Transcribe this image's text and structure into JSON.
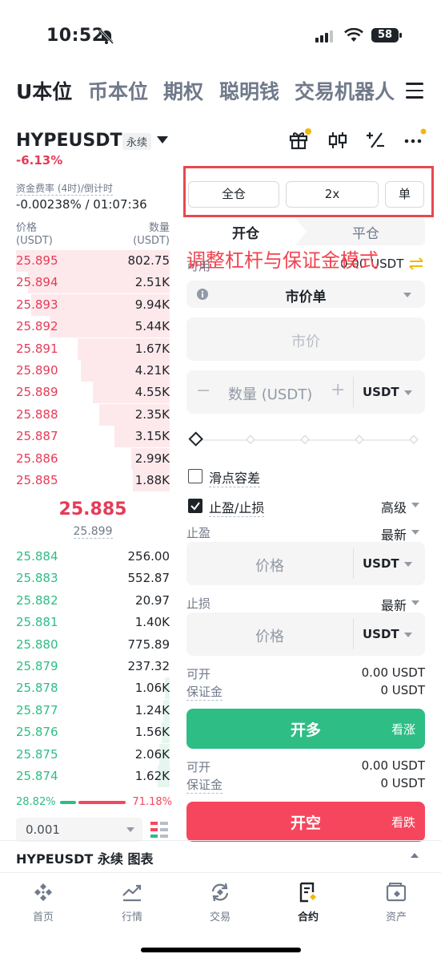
{
  "status": {
    "time": "10:52",
    "battery": "58"
  },
  "top_tabs": [
    "U本位",
    "币本位",
    "期权",
    "聪明钱",
    "交易机器人"
  ],
  "ticker": {
    "symbol": "HYPEUSDT",
    "tag": "永续",
    "change": "-6.13%",
    "funding_label": "资金费率 (4时)/倒计时",
    "funding_value": "-0.00238% / 01:07:36"
  },
  "orderbook": {
    "price_label": "价格",
    "price_unit": "(USDT)",
    "qty_label": "数量",
    "qty_unit": "(USDT)",
    "asks": [
      {
        "price": "25.895",
        "qty": "802.75",
        "depth": 1.0
      },
      {
        "price": "25.894",
        "qty": "2.51K",
        "depth": 0.92
      },
      {
        "price": "25.893",
        "qty": "9.94K",
        "depth": 0.9
      },
      {
        "price": "25.892",
        "qty": "5.44K",
        "depth": 0.78
      },
      {
        "price": "25.891",
        "qty": "1.67K",
        "depth": 0.6
      },
      {
        "price": "25.890",
        "qty": "4.21K",
        "depth": 0.58
      },
      {
        "price": "25.889",
        "qty": "4.55K",
        "depth": 0.5
      },
      {
        "price": "25.888",
        "qty": "2.35K",
        "depth": 0.46
      },
      {
        "price": "25.887",
        "qty": "3.15K",
        "depth": 0.36
      },
      {
        "price": "25.886",
        "qty": "2.99K",
        "depth": 0.25
      },
      {
        "price": "25.885",
        "qty": "1.88K",
        "depth": 0.24
      }
    ],
    "last_price": "25.885",
    "mark_price": "25.899",
    "bids": [
      {
        "price": "25.884",
        "qty": "256.00",
        "depth": 0.0
      },
      {
        "price": "25.883",
        "qty": "552.87",
        "depth": 0.0
      },
      {
        "price": "25.882",
        "qty": "20.97",
        "depth": 0.0
      },
      {
        "price": "25.881",
        "qty": "1.40K",
        "depth": 0.0
      },
      {
        "price": "25.880",
        "qty": "775.89",
        "depth": 0.0
      },
      {
        "price": "25.879",
        "qty": "237.32",
        "depth": 0.0
      },
      {
        "price": "25.878",
        "qty": "1.06K",
        "depth": 0.03
      },
      {
        "price": "25.877",
        "qty": "1.24K",
        "depth": 0.04
      },
      {
        "price": "25.876",
        "qty": "1.56K",
        "depth": 0.05
      },
      {
        "price": "25.875",
        "qty": "2.06K",
        "depth": 0.07
      },
      {
        "price": "25.874",
        "qty": "1.62K",
        "depth": 0.08
      }
    ],
    "buy_ratio": "28.82%",
    "sell_ratio": "71.18%",
    "buy_fraction": 0.2882,
    "precision": "0.001"
  },
  "order_form": {
    "margin_mode": "全仓",
    "leverage": "2x",
    "position_mode": "单",
    "open_tab": "开仓",
    "close_tab": "平仓",
    "annotation": "调整杠杆与保证金模式",
    "available_label": "可用",
    "available_value": "0.00 USDT",
    "order_type": "市价单",
    "price_placeholder": "市价",
    "qty_placeholder": "数量 (USDT)",
    "qty_unit": "USDT",
    "slippage_label": "滑点容差",
    "tpsl_label": "止盈/止损",
    "advanced_label": "高级",
    "tp_label": "止盈",
    "tp_trigger": "最新",
    "tp_placeholder": "价格",
    "tp_unit": "USDT",
    "sl_label": "止损",
    "sl_trigger": "最新",
    "sl_placeholder": "价格",
    "sl_unit": "USDT",
    "long": {
      "open_label": "可开",
      "open_value": "0.00 USDT",
      "margin_label": "保证金",
      "margin_value": "0 USDT",
      "button": "开多",
      "sub": "看涨"
    },
    "short": {
      "open_label": "可开",
      "open_value": "0.00 USDT",
      "margin_label": "保证金",
      "margin_value": "0 USDT",
      "button": "开空",
      "sub": "看跌"
    }
  },
  "chart_bar": {
    "label": "HYPEUSDT 永续 图表"
  },
  "nav": [
    "首页",
    "行情",
    "交易",
    "合约",
    "资产"
  ],
  "colors": {
    "red": "#f6465d",
    "green": "#2ebd85",
    "accent": "#f0b90b"
  }
}
